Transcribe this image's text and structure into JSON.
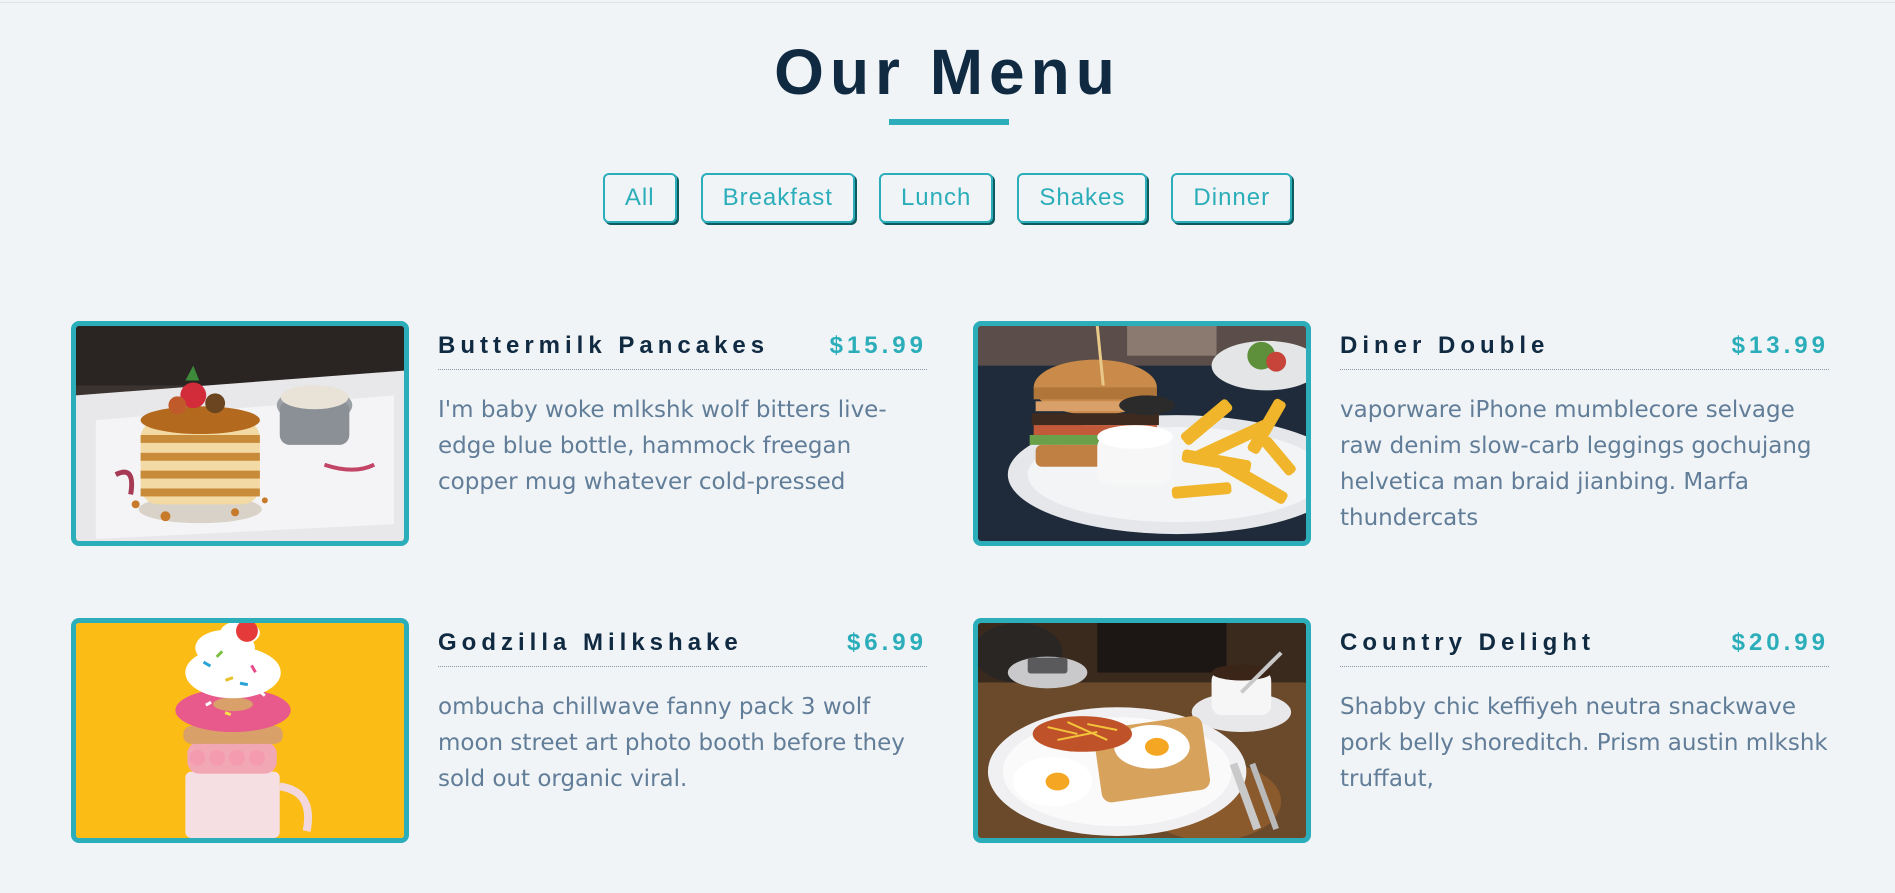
{
  "header": {
    "title": "Our Menu"
  },
  "filters": {
    "all": "All",
    "breakfast": "Breakfast",
    "lunch": "Lunch",
    "shakes": "Shakes",
    "dinner": "Dinner"
  },
  "menu": {
    "items": [
      {
        "name": "Buttermilk Pancakes",
        "price": "$15.99",
        "description": "I'm baby woke mlkshk wolf bitters live-edge blue bottle, hammock freegan copper mug whatever cold-pressed",
        "image": "pancakes-photo"
      },
      {
        "name": "Diner Double",
        "price": "$13.99",
        "description": "vaporware iPhone mumblecore selvage raw denim slow-carb leggings gochujang helvetica man braid jianbing. Marfa thundercats",
        "image": "burger-photo"
      },
      {
        "name": "Godzilla Milkshake",
        "price": "$6.99",
        "description": "ombucha chillwave fanny pack 3 wolf moon street art photo booth before they sold out organic viral.",
        "image": "milkshake-photo"
      },
      {
        "name": "Country Delight",
        "price": "$20.99",
        "description": "Shabby chic keffiyeh neutra snackwave pork belly shoreditch. Prism austin mlkshk truffaut,",
        "image": "breakfast-plate-photo"
      }
    ]
  },
  "colors": {
    "accent": "#2caeba",
    "heading": "#102a42",
    "text": "#617d98",
    "background": "#f0f4f7"
  }
}
